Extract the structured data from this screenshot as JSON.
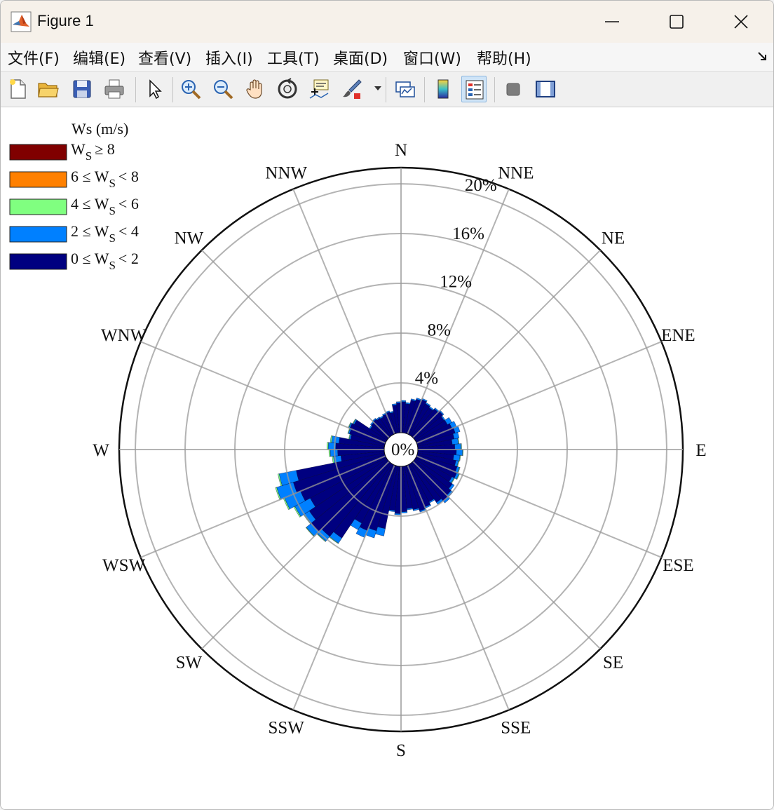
{
  "window": {
    "title": "Figure 1"
  },
  "menu": [
    {
      "label": "文件(F)",
      "name": "menu-file"
    },
    {
      "label": "编辑(E)",
      "name": "menu-edit"
    },
    {
      "label": "查看(V)",
      "name": "menu-view"
    },
    {
      "label": "插入(I)",
      "name": "menu-insert"
    },
    {
      "label": "工具(T)",
      "name": "menu-tools"
    },
    {
      "label": "桌面(D)",
      "name": "menu-desktop"
    },
    {
      "label": "窗口(W)",
      "name": "menu-window"
    },
    {
      "label": "帮助(H)",
      "name": "menu-help"
    }
  ],
  "toolbar": [
    {
      "icon": "new-figure-icon"
    },
    {
      "icon": "open-file-icon"
    },
    {
      "icon": "save-icon"
    },
    {
      "icon": "print-icon"
    },
    {
      "icon": "pointer-icon"
    },
    {
      "icon": "zoom-in-icon"
    },
    {
      "icon": "zoom-out-icon"
    },
    {
      "icon": "pan-hand-icon"
    },
    {
      "icon": "rotate-3d-icon"
    },
    {
      "icon": "data-cursor-icon"
    },
    {
      "icon": "brush-icon"
    },
    {
      "icon": "link-plot-icon"
    },
    {
      "icon": "colorbar-icon"
    },
    {
      "icon": "legend-icon"
    },
    {
      "icon": "hide-plot-tools-icon"
    },
    {
      "icon": "show-plot-tools-icon"
    }
  ],
  "chart_data": {
    "type": "windrose",
    "directions": [
      "N",
      "NNE",
      "NE",
      "ENE",
      "E",
      "ESE",
      "SE",
      "SSE",
      "S",
      "SSW",
      "SW",
      "WSW",
      "W",
      "WNW",
      "NW",
      "NNW"
    ],
    "sector_centers_deg": [
      0,
      22.5,
      45,
      67.5,
      90,
      112.5,
      135,
      157.5,
      180,
      202.5,
      225,
      247.5,
      270,
      292.5,
      315,
      337.5
    ],
    "rings": [
      0,
      4,
      8,
      12,
      16,
      20
    ],
    "ring_labels": [
      "0%",
      "4%",
      "8%",
      "12%",
      "16%",
      "20%"
    ],
    "r_max": 21.3,
    "legend_title": "Ws (m/s)",
    "series": [
      {
        "name": "0 ≤ WS < 2",
        "color": "#000080",
        "values": [
          2.5,
          3.0,
          3.0,
          3.2,
          3.1,
          3.5,
          4.0,
          3.8,
          3.8,
          5.7,
          8.0,
          7.7,
          3.9,
          3.1,
          1.8,
          1.8
        ]
      },
      {
        "name": "2 ≤ WS < 4",
        "color": "#0080ff",
        "values": [
          0.1,
          0.1,
          0.1,
          0.4,
          0.5,
          0.2,
          0.2,
          0.1,
          0.1,
          0.6,
          0.5,
          1.4,
          0.6,
          0.1,
          0.1,
          0.1
        ]
      },
      {
        "name": "4 ≤ WS < 6",
        "color": "#80ff80",
        "values": [
          0,
          0,
          0,
          0,
          0.05,
          0.05,
          0,
          0,
          0,
          0,
          0.05,
          0.1,
          0.1,
          0.05,
          0,
          0
        ]
      },
      {
        "name": "6 ≤ WS < 8",
        "color": "#ff8000",
        "values": [
          0,
          0,
          0,
          0,
          0,
          0,
          0,
          0,
          0,
          0,
          0,
          0,
          0,
          0,
          0,
          0
        ]
      },
      {
        "name": "WS ≥ 8",
        "color": "#800000",
        "values": [
          0,
          0,
          0,
          0,
          0,
          0,
          0,
          0,
          0,
          0,
          0,
          0,
          0,
          0,
          0,
          0
        ]
      }
    ],
    "legend": [
      {
        "color": "#800000",
        "base": "W",
        "sub": "S",
        "rel": "≥ 8",
        "pre": ""
      },
      {
        "color": "#ff8000",
        "base": "W",
        "sub": "S",
        "rel": "< 8",
        "pre": "6 ≤ "
      },
      {
        "color": "#80ff80",
        "base": "W",
        "sub": "S",
        "rel": "< 6",
        "pre": "4 ≤ "
      },
      {
        "color": "#0080ff",
        "base": "W",
        "sub": "S",
        "rel": "< 4",
        "pre": "2 ≤ "
      },
      {
        "color": "#000080",
        "base": "W",
        "sub": "S",
        "rel": "< 2",
        "pre": "0 ≤ "
      }
    ]
  }
}
